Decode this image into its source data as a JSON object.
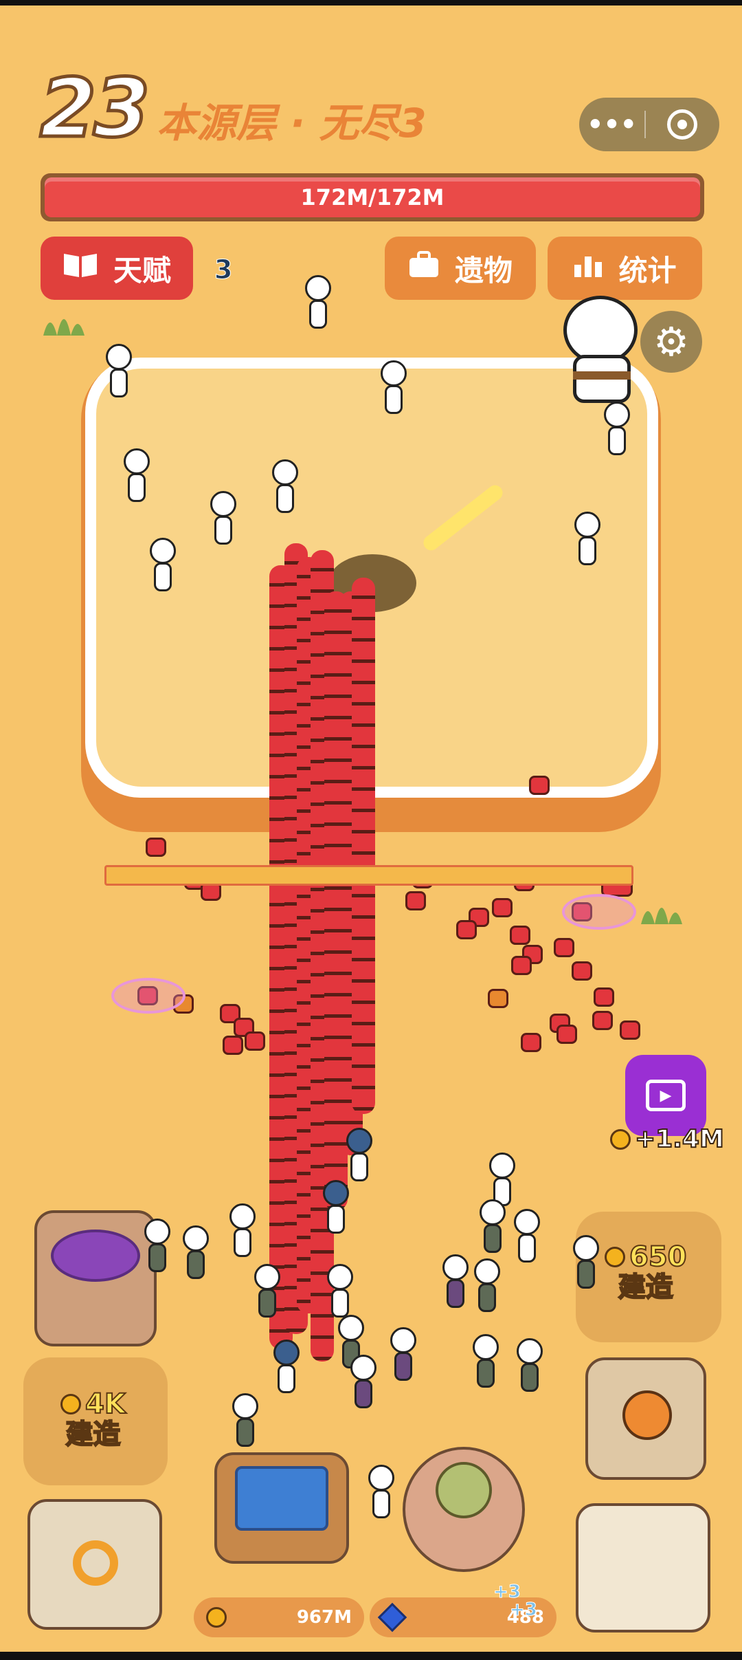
{
  "header": {
    "level_number": "23",
    "level_title": "本源层 · 无尽3",
    "menu_icon": "more-dots-icon",
    "close_icon": "target-circle-icon"
  },
  "boss_hp": {
    "label": "172M/172M",
    "fraction": 1.0,
    "color": "#ea4a48"
  },
  "buttons": {
    "talent": "天赋",
    "talent_badge": "3",
    "relic": "遗物",
    "stats": "统计"
  },
  "wave_progress": {
    "fraction": 1.0
  },
  "video_reward": {
    "amount": "+1.4M"
  },
  "build_slots": [
    {
      "cost": "650",
      "action": "建造"
    },
    {
      "cost": "4K",
      "action": "建造"
    }
  ],
  "resources": {
    "gold": "967M",
    "gems": "488",
    "gem_gain_1": "+3",
    "gem_gain_2": "+3"
  },
  "colors": {
    "background": "#f7c46a",
    "accent_red": "#e0403c",
    "accent_orange": "#e98a3c",
    "video_purple": "#9a2fd3"
  }
}
